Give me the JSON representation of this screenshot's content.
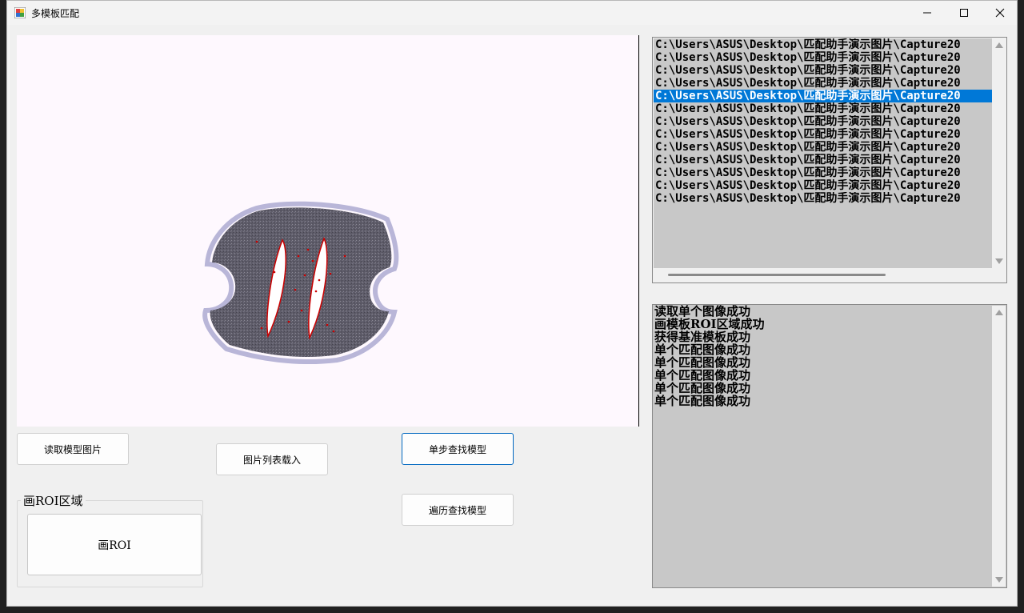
{
  "window": {
    "title": "多模板匹配",
    "minimize_icon": "minimize-icon",
    "maximize_icon": "maximize-icon",
    "close_icon": "close-icon"
  },
  "buttons": {
    "read_model_image": "读取模型图片",
    "load_image_list": "图片列表载入",
    "step_find_model": "单步查找模型",
    "traverse_find_model": "遍历查找模型"
  },
  "roi_group": {
    "label": "画ROI区域",
    "draw_roi_button": "画ROI"
  },
  "file_list": {
    "items": [
      "C:\\Users\\ASUS\\Desktop\\匹配助手演示图片\\Capture20",
      "C:\\Users\\ASUS\\Desktop\\匹配助手演示图片\\Capture20",
      "C:\\Users\\ASUS\\Desktop\\匹配助手演示图片\\Capture20",
      "C:\\Users\\ASUS\\Desktop\\匹配助手演示图片\\Capture20",
      "C:\\Users\\ASUS\\Desktop\\匹配助手演示图片\\Capture20",
      "C:\\Users\\ASUS\\Desktop\\匹配助手演示图片\\Capture20",
      "C:\\Users\\ASUS\\Desktop\\匹配助手演示图片\\Capture20",
      "C:\\Users\\ASUS\\Desktop\\匹配助手演示图片\\Capture20",
      "C:\\Users\\ASUS\\Desktop\\匹配助手演示图片\\Capture20",
      "C:\\Users\\ASUS\\Desktop\\匹配助手演示图片\\Capture20",
      "C:\\Users\\ASUS\\Desktop\\匹配助手演示图片\\Capture20",
      "C:\\Users\\ASUS\\Desktop\\匹配助手演示图片\\Capture20",
      "C:\\Users\\ASUS\\Desktop\\匹配助手演示图片\\Capture20"
    ],
    "selected_index": 4
  },
  "log": {
    "lines": [
      "读取单个图像成功",
      "画模板ROI区域成功",
      "获得基准模板成功",
      "单个匹配图像成功",
      "单个匹配图像成功",
      "单个匹配图像成功",
      "单个匹配图像成功",
      "单个匹配图像成功"
    ]
  },
  "colors": {
    "selection": "#0078d7",
    "match_contour": "#cc0000",
    "focus_border": "#0067c0"
  }
}
